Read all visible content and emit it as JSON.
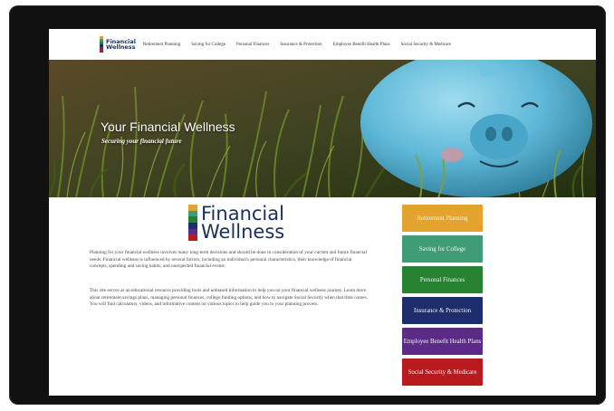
{
  "site": {
    "logo_line1": "Financial",
    "logo_line2": "Wellness"
  },
  "nav": {
    "items": [
      {
        "label": "Retirement Planning"
      },
      {
        "label": "Saving for College"
      },
      {
        "label": "Personal Finances"
      },
      {
        "label": "Insurance & Protection"
      },
      {
        "label": "Employee Benefit Health Plans"
      },
      {
        "label": "Social Security & Medicare"
      }
    ]
  },
  "hero": {
    "title": "Your Financial Wellness",
    "subtitle": "Securing your financial future"
  },
  "main": {
    "logo_line1": "Financial",
    "logo_line2": "Wellness",
    "paragraph1": "Planning for your financial wellness involves many long-term decisions and should be done in consideration of your current and future financial needs. Financial wellness is influenced by several factors, including an individual's personal characteristics, their knowledge of financial concepts, spending and saving habits, and unexpected financial events.",
    "paragraph2": "This site serves as an educational resource providing tools and unbiased information to help you on your financial wellness journey. Learn more about retirement savings plans, managing personal finances, college funding options, and how to navigate Social Security when that time comes. You will find calculators, videos, and informative content on various topics to help guide you in your planning process."
  },
  "side_buttons": [
    {
      "label": "Retirement Planning",
      "color": "#e3a32c"
    },
    {
      "label": "Saving for College",
      "color": "#3f9c77"
    },
    {
      "label": "Personal Finances",
      "color": "#278232"
    },
    {
      "label": "Insurance & Protection",
      "color": "#1e2d6c"
    },
    {
      "label": "Employee Benefit Health Plans",
      "color": "#5b2b87"
    },
    {
      "label": "Social Security & Medicare",
      "color": "#b81a1e"
    }
  ],
  "colors": {
    "brand_navy": "#1a2f5c",
    "logo_stripes": [
      "#e3a32c",
      "#3f9c77",
      "#278232",
      "#1e2d6c",
      "#5b2b87",
      "#b81a1e"
    ],
    "piggy_bank": "#5fb8d8"
  },
  "icons": {
    "logo_mark": "color-bar-stack-icon",
    "hero_image": "piggy-bank-in-grass"
  }
}
